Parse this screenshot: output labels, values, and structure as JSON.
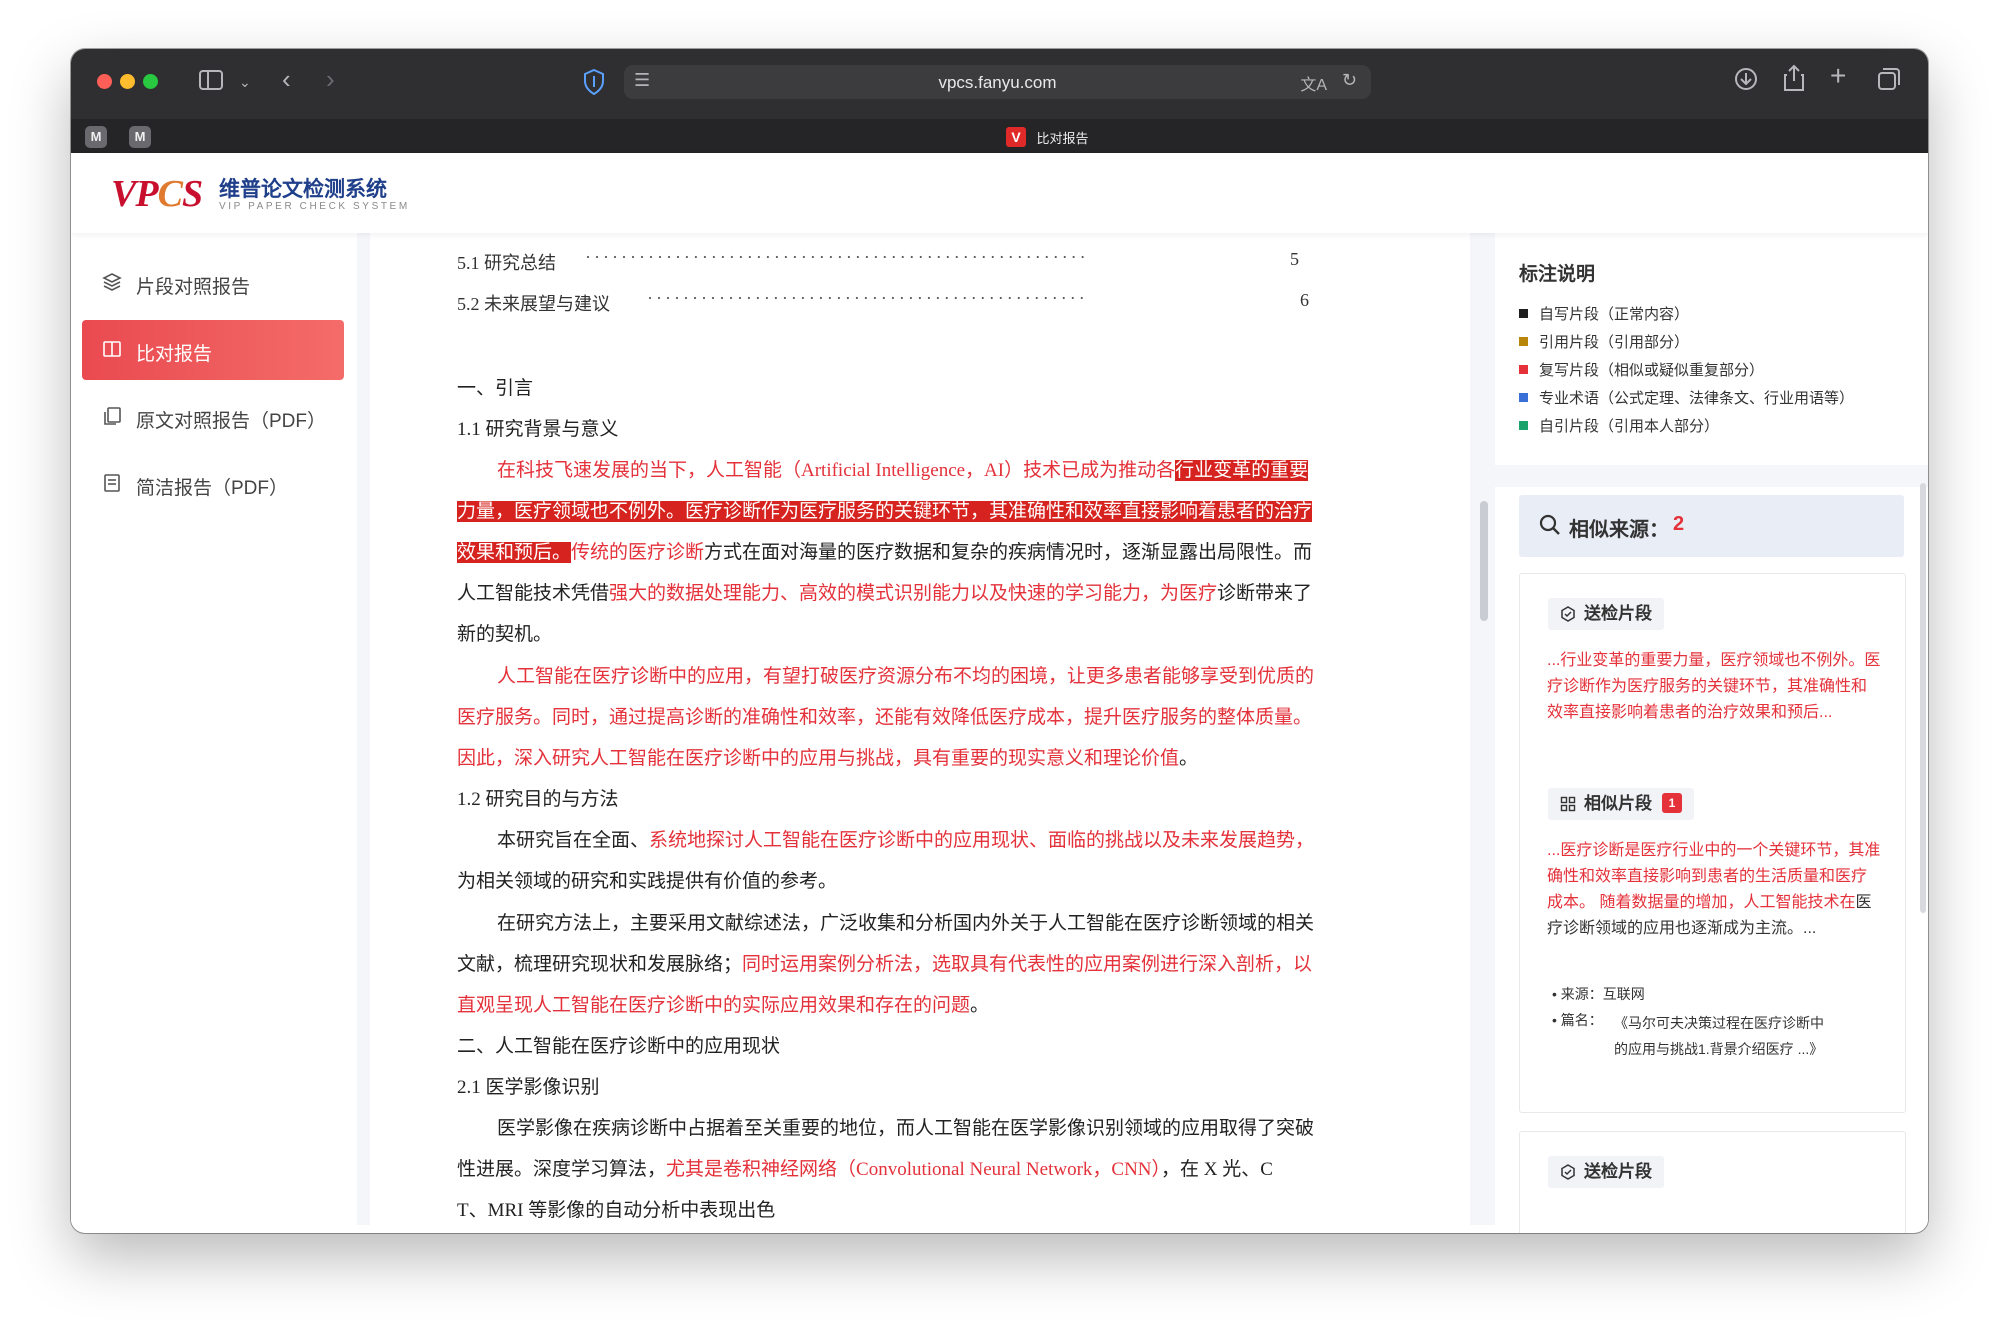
{
  "browser": {
    "url": "vpcs.fanyu.com",
    "tab_title": "比对报告",
    "tab_favicon": "V",
    "pinned_tabs": [
      "M",
      "M"
    ]
  },
  "site": {
    "logo_mark": "VPCS",
    "logo_cn": "维普论文检测系统",
    "logo_en": "VIP PAPER CHECK SYSTEM"
  },
  "sidebar": {
    "items": [
      {
        "label": "片段对照报告",
        "icon": "layers-icon",
        "active": false
      },
      {
        "label": "比对报告",
        "icon": "book-open-icon",
        "active": true
      },
      {
        "label": "原文对照报告（PDF）",
        "icon": "copy-icon",
        "active": false
      },
      {
        "label": "简洁报告（PDF）",
        "icon": "document-icon",
        "active": false
      }
    ]
  },
  "paper": {
    "toc": [
      {
        "label": "5.1 研究总结",
        "page": "5"
      },
      {
        "label": "5.2 未来展望与建议",
        "page": "6"
      }
    ],
    "h_intro": "一、引言",
    "h_1_1": "1.1 研究背景与意义",
    "p1": {
      "a": "在科技飞速发展的当下，人工智能（Artificial Intelligence，AI）技术已成为推动各",
      "b": "行业变革的重要",
      "c": "力量，医疗领域也不例外。医疗诊断作为医疗服务的关键环节，其准确性和效率直接影响着患者的治疗",
      "d": "效果和预后。",
      "e": "传统的医疗诊断",
      "f": "方式在面对海量的医疗数据和复杂的疾病情况时，逐渐显露出局限性。而",
      "g": "人工智能技术凭借",
      "h": "强大的数据处理能力、高效的模式识别能力以及快速的学习能力，为医疗",
      "i": "诊断带来了",
      "j": "新的契机。"
    },
    "p2": {
      "a": "人工智能在医疗诊断中的应用，有望打破医疗资源分布不均的困境，让更多患者能够享受到优质的",
      "b": "医疗服务。同时，通过提高诊断的准确性和效率，还能有效降低医疗成本，提升医疗服务的整体质量。",
      "c": "因此，深入研究人工智能在医疗诊断中的应用与挑战，具有重要的现实意义和理论价值",
      "d": "。"
    },
    "h_1_2": "1.2 研究目的与方法",
    "p3": {
      "a": "本研究旨在全面、",
      "b": "系统地探讨人工智能在医疗诊断中的应用现状、面临的挑战以及未来发展趋势，",
      "c": "为相关领域的研究和实践提供有价值的参考。"
    },
    "p4": {
      "a": "在研究方法上，主要采用文献综述法，广泛收集和分析国内外关于人工智能在医疗诊断领域的相关",
      "b": "文献，梳理研究现状和发展脉络；",
      "c": "同时运用案例分析法，选取具有代表性的应用案例进行深入剖析，以",
      "d": "直观呈现人工智能在医疗诊断中的实际应用效果和存在的问题",
      "e": "。"
    },
    "h_2": "二、人工智能在医疗诊断中的应用现状",
    "h_2_1": "2.1 医学影像识别",
    "p5": {
      "a": "医学影像在疾病诊断中占据着至关重要的地位，而人工智能在医学影像识别领域的应用取得了突破",
      "b": "性进展。深度学习算法，",
      "c": "尤其是卷积神经网络（Convolutional Neural Network，CNN）",
      "d": "，在 X 光、C",
      "e": "T、MRI 等影像的自动分析中表现出色"
    }
  },
  "legend": {
    "title": "标注说明",
    "items": [
      {
        "label": "自写片段（正常内容）",
        "color": "#1f1f1f"
      },
      {
        "label": "引用片段（引用部分）",
        "color": "#b8860b"
      },
      {
        "label": "复写片段（相似或疑似重复部分）",
        "color": "#e4313a"
      },
      {
        "label": "专业术语（公式定理、法律条文、行业用语等）",
        "color": "#3a6fd8"
      },
      {
        "label": "自引片段（引用本人部分）",
        "color": "#1aa36a"
      }
    ]
  },
  "similar": {
    "label": "相似来源：",
    "count": "2",
    "submitted_tag": "送检片段",
    "submitted_text": "...行业变革的重要力量，医疗领域也不例外。医疗诊断作为医疗服务的关键环节，其准确性和效率直接影响着患者的治疗效果和预后...",
    "similar_tag": "相似片段",
    "similar_badge": "1",
    "similar_text_red": "...医疗诊断是医疗行业中的一个关键环节，其准确性和效率直接影响到患者的生活质量和医疗成本。 随着数据量的增加，人工智能技术在",
    "similar_text_black": "医疗诊断领域的应用也逐渐成为主流。...",
    "source_label": "来源：",
    "source_value": "互联网",
    "title_label": "篇名：",
    "title_value": "《马尔可夫决策过程在医疗诊断中的应用与挑战1.背景介绍医疗 ...》",
    "next_tag": "送检片段"
  }
}
